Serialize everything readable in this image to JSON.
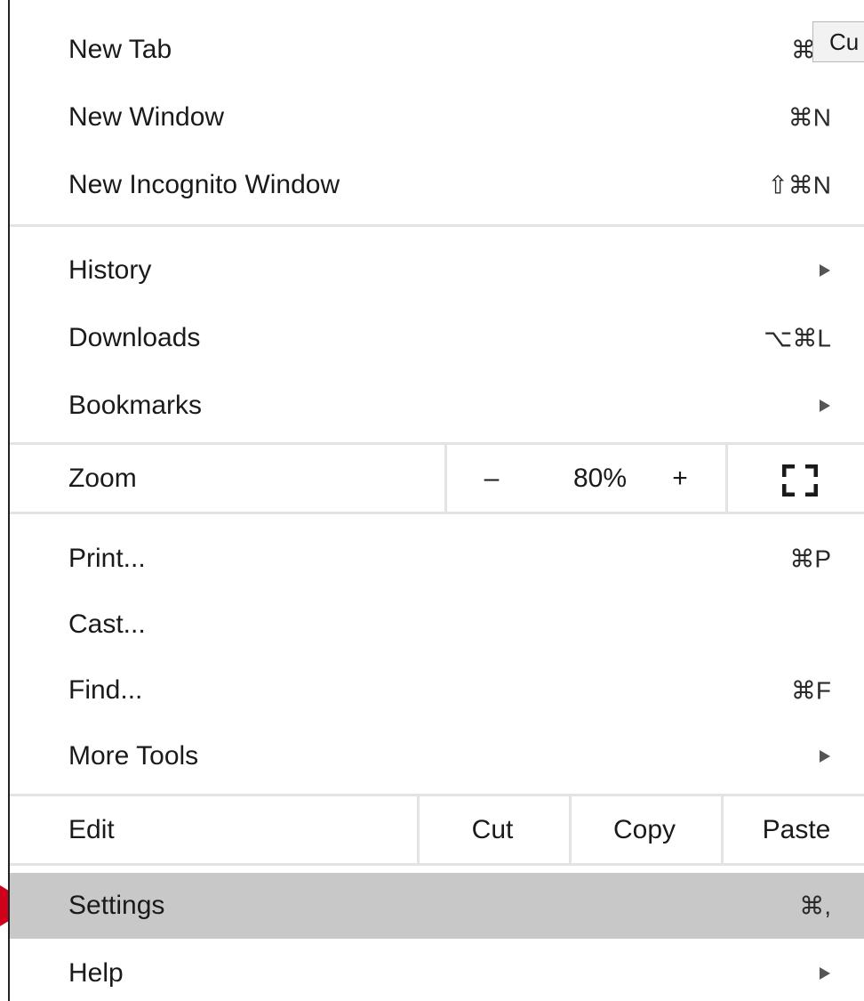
{
  "menu": {
    "new_tab": {
      "label": "New Tab",
      "shortcut": "⌘T"
    },
    "new_window": {
      "label": "New Window",
      "shortcut": "⌘N"
    },
    "new_incognito": {
      "label": "New Incognito Window",
      "shortcut": "⇧⌘N"
    },
    "history": {
      "label": "History"
    },
    "downloads": {
      "label": "Downloads",
      "shortcut": "⌥⌘L"
    },
    "bookmarks": {
      "label": "Bookmarks"
    },
    "zoom": {
      "label": "Zoom",
      "minus": "–",
      "value": "80%",
      "plus": "+",
      "fullscreen_icon": "fullscreen-icon"
    },
    "print": {
      "label": "Print...",
      "shortcut": "⌘P"
    },
    "cast": {
      "label": "Cast..."
    },
    "find": {
      "label": "Find...",
      "shortcut": "⌘F"
    },
    "more_tools": {
      "label": "More Tools"
    },
    "edit": {
      "label": "Edit",
      "cut": "Cut",
      "copy": "Copy",
      "paste": "Paste"
    },
    "settings": {
      "label": "Settings",
      "shortcut": "⌘,"
    },
    "help": {
      "label": "Help"
    }
  },
  "tooltip": {
    "text": "Cu"
  },
  "annotation": {
    "pointer_icon": "red-arrow-icon",
    "color": "#d0021b"
  },
  "colors": {
    "highlight": "#c8c8c8",
    "separator": "#e3e3e3",
    "text": "#1a1a1a"
  }
}
